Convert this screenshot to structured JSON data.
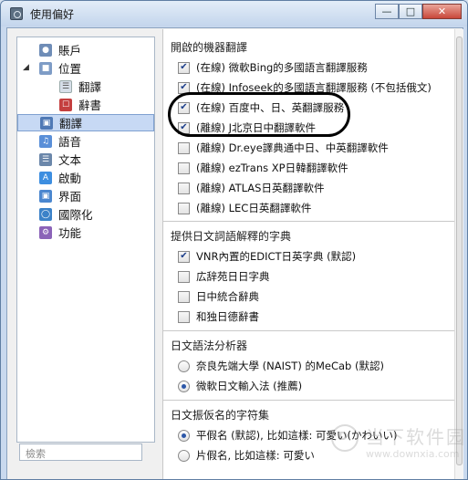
{
  "window": {
    "title": "使用偏好"
  },
  "sidebar": {
    "items": [
      {
        "label": "賬戶",
        "icon": "account-icon"
      },
      {
        "label": "位置",
        "icon": "location-icon"
      },
      {
        "label": "翻譯",
        "icon": "translation-icon"
      },
      {
        "label": "辭書",
        "icon": "dictionary-icon"
      },
      {
        "label": "翻譯",
        "icon": "translate-icon"
      },
      {
        "label": "語音",
        "icon": "music-note-icon"
      },
      {
        "label": "文本",
        "icon": "text-icon"
      },
      {
        "label": "啟動",
        "icon": "launch-icon"
      },
      {
        "label": "界面",
        "icon": "interface-icon"
      },
      {
        "label": "國際化",
        "icon": "globe-icon"
      },
      {
        "label": "功能",
        "icon": "settings-icon"
      }
    ],
    "search_placeholder": "檢索"
  },
  "sections": [
    {
      "title": "開啟的機器翻譯",
      "options": [
        {
          "label": "(在線) 微軟Bing的多國語言翻譯服務",
          "checked": true
        },
        {
          "label": "(在線) Infoseek的多國語言翻譯服務 (不包括俄文)",
          "checked": true
        },
        {
          "label": "(在線) 百度中、日、英翻譯服務",
          "checked": true
        },
        {
          "label": "(離線) J北京日中翻譯軟件",
          "checked": true
        },
        {
          "label": "(離線) Dr.eye譯典通中日、中英翻譯軟件",
          "checked": false
        },
        {
          "label": "(離線) ezTrans XP日韓翻譯軟件",
          "checked": false
        },
        {
          "label": "(離線) ATLAS日英翻譯軟件",
          "checked": false
        },
        {
          "label": "(離線) LEC日英翻譯軟件",
          "checked": false
        }
      ]
    },
    {
      "title": "提供日文詞語解釋的字典",
      "options": [
        {
          "label": "VNR內置的EDICT日英字典 (默認)",
          "checked": true
        },
        {
          "label": "広辞苑日日字典",
          "checked": false
        },
        {
          "label": "日中統合辭典",
          "checked": false
        },
        {
          "label": "和独日德辭書",
          "checked": false
        }
      ]
    },
    {
      "title": "日文語法分析器",
      "options": [
        {
          "label": "奈良先端大學 (NAIST) 的MeCab (默認)",
          "selected": false
        },
        {
          "label": "微軟日文輸入法 (推薦)",
          "selected": true
        }
      ]
    },
    {
      "title": "日文振仮名的字符集",
      "options": [
        {
          "label": "平假名 (默認), 比如這樣: 可愛い(かわいい)",
          "selected": true
        },
        {
          "label": "片假名, 比如這樣: 可愛い",
          "selected": false
        }
      ]
    }
  ],
  "watermark": {
    "brand": "当下软件园",
    "url": "www.downxia.com"
  },
  "colors": {
    "accent": "#2c57a8",
    "selection": "#c7d9f4"
  }
}
